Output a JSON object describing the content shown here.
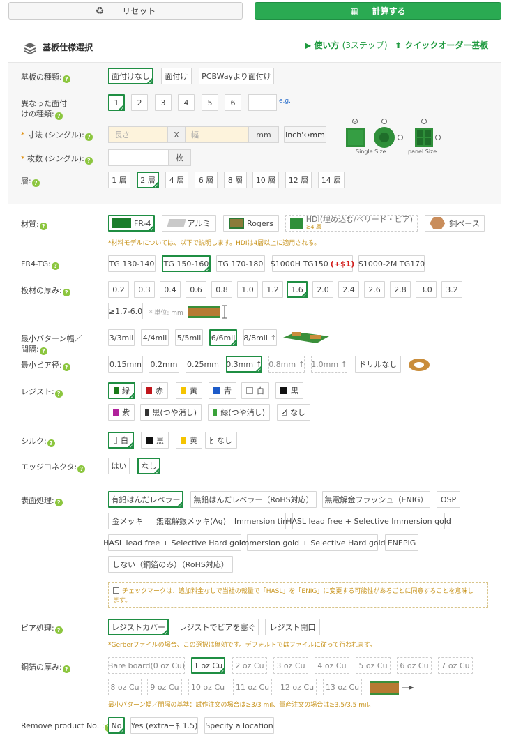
{
  "top": {
    "reset_label": "リセット",
    "calc_label": "計算する"
  },
  "header": {
    "title": "基板仕様選択",
    "howto": "使い方",
    "howto_paren": "(3ステップ)",
    "quick": "クイックオーダー基板"
  },
  "board_type": {
    "label": "基板の種類:",
    "options": [
      "面付けなし",
      "面付け",
      "PCBWayより面付け"
    ],
    "selected": 0
  },
  "design_count": {
    "label_line1": "異なった面付",
    "label_line2": "けの種類:",
    "options": [
      "1",
      "2",
      "3",
      "4",
      "5",
      "6"
    ],
    "selected": 0,
    "input_value": "",
    "eg": "e.g."
  },
  "size": {
    "label": "* 寸法 (シングル):",
    "length_placeholder": "長さ",
    "x": "X",
    "width_placeholder": "幅",
    "unit": "mm",
    "convert": "inch'↔mm",
    "single_caption": "Single Size",
    "panel_caption": "panel Size"
  },
  "qty": {
    "label": "* 枚数 (シングル):",
    "unit": "枚"
  },
  "layers": {
    "label": "層:",
    "options": [
      "1 層",
      "2 層",
      "4 層",
      "6 層",
      "8 層",
      "10 層",
      "12 層",
      "14 層"
    ],
    "selected": 1
  },
  "material": {
    "label": "材質:",
    "options": [
      "FR-4",
      "アルミ",
      "Rogers",
      "HDI(埋め込む/ベリード・ビア)",
      "銅ベース"
    ],
    "hdi_sub": "≥4 層",
    "selected": 0,
    "note": "*材料モデルについては、以下で説明します。HDIは4層以上に適用される。"
  },
  "tg": {
    "label": "FR4-TG:",
    "options": [
      "TG 130-140",
      "TG 150-160",
      "TG 170-180",
      "S1000H TG150",
      "S1000-2M TG170"
    ],
    "surcharge": "(+$1)",
    "selected": 1
  },
  "thickness": {
    "label": "板材の厚み:",
    "options": [
      "0.2",
      "0.3",
      "0.4",
      "0.6",
      "0.8",
      "1.0",
      "1.2",
      "1.6",
      "2.0",
      "2.4",
      "2.6",
      "2.8",
      "3.0",
      "3.2"
    ],
    "extra": "≥1.7-6.0",
    "unit_note": "* 単位: mm",
    "selected": 7
  },
  "trace": {
    "label_line1": "最小パターン幅／",
    "label_line2": "間隔:",
    "options": [
      "3/3mil",
      "4/4mil",
      "5/5mil",
      "6/6mil",
      "8/8mil ↑"
    ],
    "selected": 3
  },
  "via": {
    "label": "最小ビア径:",
    "options": [
      "0.15mm",
      "0.2mm",
      "0.25mm",
      "0.3mm ↑",
      "0.8mm ↑",
      "1.0mm ↑",
      "ドリルなし"
    ],
    "selected": 3
  },
  "mask": {
    "label": "レジスト:",
    "options": [
      "緑",
      "赤",
      "黄",
      "青",
      "白",
      "黒",
      "紫",
      "黒(つや消し)",
      "緑(つや消し)",
      "なし"
    ],
    "colors": [
      "#1a7a1a",
      "#c0151b",
      "#f5c400",
      "#1d5bc9",
      "#ffffff",
      "#111111",
      "#b0229b",
      "#333333",
      "#3aa23a",
      "none"
    ],
    "selected": 0
  },
  "silk": {
    "label": "シルク:",
    "options": [
      "白",
      "黒",
      "黄",
      "なし"
    ],
    "colors": [
      "#ffffff",
      "#111111",
      "#f5c400",
      "none"
    ],
    "selected": 0
  },
  "edge": {
    "label": "エッジコネクタ:",
    "options": [
      "はい",
      "なし"
    ],
    "selected": 1
  },
  "finish": {
    "label": "表面処理:",
    "options": [
      "有鉛はんだレベラー",
      "無鉛はんだレベラー（RoHS対応）",
      "無電解金フラッシュ（ENIG）",
      "OSP",
      "金メッキ",
      "無電解銀メッキ(Ag)",
      "Immersion tin",
      "HASL lead free + Selective Immersion gold",
      "HASL lead free + Selective Hard gold",
      "Immersion gold + Selective Hard gold",
      "ENEPIG",
      "しない（銅箔のみ）（RoHS対応）"
    ],
    "selected": 0,
    "check_line1": "チェックマークは、追加料金なしで当社の裁量で「HASL」を「ENIG」に変更する可能性があるごとに同意することを意味し",
    "check_line2": "ます。"
  },
  "via_process": {
    "label": "ビア処理:",
    "options": [
      "レジストカバー",
      "レジストでビアを塞ぐ",
      "レジスト開口"
    ],
    "selected": 0,
    "note": "*Gerberファイルの場合、この選択は無効です。デフォルトではファイルに従って行われます。"
  },
  "copper": {
    "label": "銅箔の厚み:",
    "options": [
      "Bare board(0 oz Cu)",
      "1 oz Cu",
      "2 oz Cu",
      "3 oz Cu",
      "4 oz Cu",
      "5 oz Cu",
      "6 oz Cu",
      "7 oz Cu",
      "8 oz Cu",
      "9 oz Cu",
      "10 oz Cu",
      "11 oz Cu",
      "12 oz Cu",
      "13 oz Cu"
    ],
    "selected": 1,
    "note": "最小パターン幅／間隔の基準：試作注文の場合は≥3/3 mil、量産注文の場合は≥3.5/3.5 mil。"
  },
  "remove_no": {
    "label": "Remove product No. :",
    "options": [
      "No",
      "Yes (extra+$ 1.5)",
      "Specify a location"
    ],
    "selected": 0
  }
}
